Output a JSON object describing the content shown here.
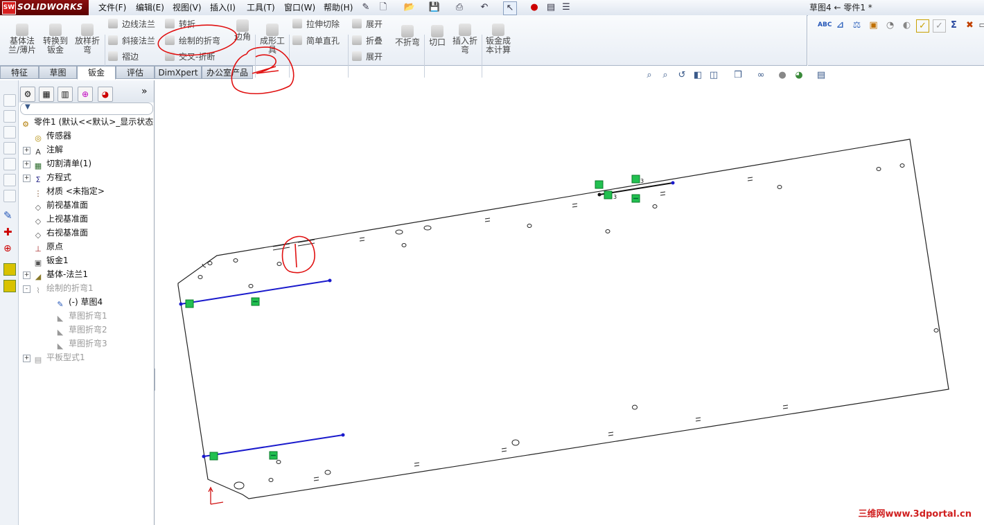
{
  "app": {
    "logo_text": "SOLIDWORKS",
    "logo_badge": "SW",
    "document_title": "草图4 ← 零件1 *"
  },
  "menu": [
    "文件(F)",
    "编辑(E)",
    "视图(V)",
    "插入(I)",
    "工具(T)",
    "窗口(W)",
    "帮助(H)"
  ],
  "toolbar": {
    "big_tools": [
      "基体法\n兰/薄片",
      "转换到\n钣金",
      "放样折\n弯"
    ],
    "group1": [
      "边线法兰",
      "斜接法兰",
      "褶边"
    ],
    "group2": [
      "转折",
      "绘制的折弯",
      "交叉-折断"
    ],
    "corner": "边角",
    "forming": "成形工\n具",
    "group3": [
      "拉伸切除",
      "简单直孔"
    ],
    "group4": [
      "展开",
      "折叠",
      "展开"
    ],
    "no_bend": "不折弯",
    "cut": "切口",
    "insert_bend": "插入折\n弯",
    "cost": "钣金成\n本计算"
  },
  "tabs": [
    "特征",
    "草图",
    "钣金",
    "评估",
    "DimXpert",
    "办公室产品"
  ],
  "active_tab": "钣金",
  "feature_tree": [
    {
      "label": "零件1  (默认<<默认>_显示状态",
      "icon": "part-icon",
      "exp": "",
      "indent": 0,
      "gray": false
    },
    {
      "label": "传感器",
      "icon": "sensor-icon",
      "exp": "",
      "indent": 1,
      "gray": false
    },
    {
      "label": "注解",
      "icon": "annotation-icon",
      "exp": "+",
      "indent": 1,
      "gray": false
    },
    {
      "label": "切割清单(1)",
      "icon": "cutlist-icon",
      "exp": "+",
      "indent": 1,
      "gray": false
    },
    {
      "label": "方程式",
      "icon": "equation-icon",
      "exp": "+",
      "indent": 1,
      "gray": false
    },
    {
      "label": "材质 <未指定>",
      "icon": "material-icon",
      "exp": "",
      "indent": 1,
      "gray": false
    },
    {
      "label": "前视基准面",
      "icon": "plane-icon",
      "exp": "",
      "indent": 1,
      "gray": false
    },
    {
      "label": "上视基准面",
      "icon": "plane-icon",
      "exp": "",
      "indent": 1,
      "gray": false
    },
    {
      "label": "右视基准面",
      "icon": "plane-icon",
      "exp": "",
      "indent": 1,
      "gray": false
    },
    {
      "label": "原点",
      "icon": "origin-icon",
      "exp": "",
      "indent": 1,
      "gray": false
    },
    {
      "label": "钣金1",
      "icon": "sheetmetal-icon",
      "exp": "",
      "indent": 1,
      "gray": false
    },
    {
      "label": "基体-法兰1",
      "icon": "base-flange-icon",
      "exp": "+",
      "indent": 1,
      "gray": false
    },
    {
      "label": "绘制的折弯1",
      "icon": "sketched-bend-icon",
      "exp": "-",
      "indent": 1,
      "gray": true
    },
    {
      "label": "(-) 草图4",
      "icon": "sketch-icon",
      "exp": "",
      "indent": 2,
      "gray": false
    },
    {
      "label": "草图折弯1",
      "icon": "bend-icon",
      "exp": "",
      "indent": 2,
      "gray": true
    },
    {
      "label": "草图折弯2",
      "icon": "bend-icon",
      "exp": "",
      "indent": 2,
      "gray": true
    },
    {
      "label": "草图折弯3",
      "icon": "bend-icon",
      "exp": "",
      "indent": 2,
      "gray": true
    },
    {
      "label": "平板型式1",
      "icon": "flat-pattern-icon",
      "exp": "+",
      "indent": 1,
      "gray": true
    }
  ],
  "annotations": {
    "circle_one": "1",
    "circle_two": "2"
  },
  "sketch_labels": {
    "dim_a": "3",
    "dim_b": "3"
  },
  "watermark": "三维网www.3dportal.cn",
  "colors": {
    "sketch_line": "#1a1acc",
    "relation_box": "#22c050",
    "markup": "#e01010"
  }
}
